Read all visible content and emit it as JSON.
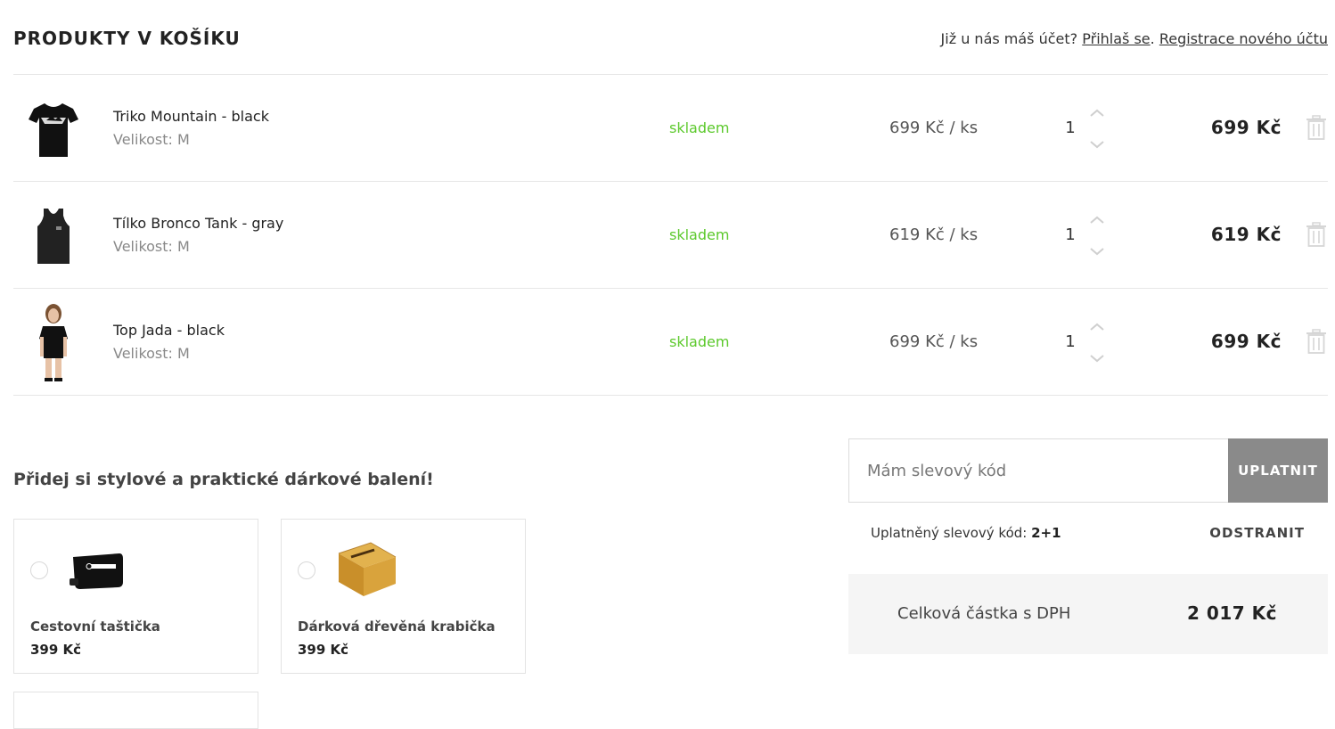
{
  "header": {
    "title": "PRODUKTY V KOŠÍKU",
    "account_prompt": "Již u nás máš účet?",
    "login_link": "Přihlaš se",
    "separator": ".",
    "register_link": "Registrace nového účtu"
  },
  "cart_items": [
    {
      "name": "Triko Mountain - black",
      "size": "Velikost: M",
      "stock": "skladem",
      "unit_price": "699 Kč / ks",
      "quantity": "1",
      "total": "699 Kč",
      "image_icon": "black-tshirt-icon"
    },
    {
      "name": "Tílko Bronco Tank - gray",
      "size": "Velikost: M",
      "stock": "skladem",
      "unit_price": "619 Kč / ks",
      "quantity": "1",
      "total": "619 Kč",
      "image_icon": "tank-top-icon"
    },
    {
      "name": "Top Jada - black",
      "size": "Velikost: M",
      "stock": "skladem",
      "unit_price": "699 Kč / ks",
      "quantity": "1",
      "total": "699 Kč",
      "image_icon": "model-top-icon"
    }
  ],
  "gift": {
    "heading": "Přidej si stylové a praktické dárkové balení!",
    "options": [
      {
        "name": "Cestovní taštička",
        "price": "399 Kč",
        "image_icon": "travel-pouch-icon"
      },
      {
        "name": "Dárková dřevěná krabička",
        "price": "399 Kč",
        "image_icon": "wooden-box-icon"
      }
    ]
  },
  "coupon": {
    "placeholder": "Mám slevový kód",
    "apply_label": "UPLATNIT",
    "applied_label": "Uplatněný slevový kód:",
    "applied_code": "2+1",
    "remove_label": "ODSTRANIT"
  },
  "summary": {
    "total_label": "Celková částka s DPH",
    "total_value": "2 017 Kč"
  },
  "colors": {
    "in_stock": "#5cc92c",
    "apply_button": "#8a8a8a",
    "summary_bg": "#f5f5f5"
  }
}
